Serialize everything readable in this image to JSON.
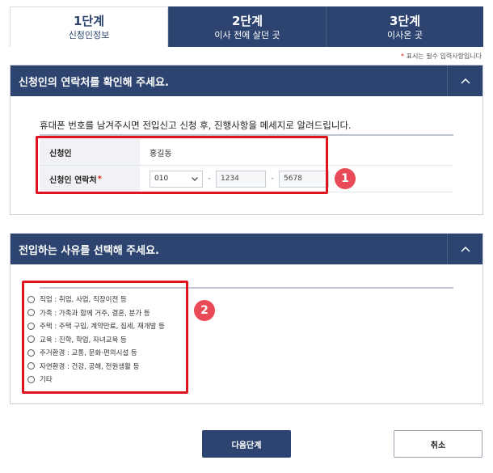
{
  "steps": [
    {
      "num": "1단계",
      "label": "신청인정보",
      "active": true
    },
    {
      "num": "2단계",
      "label": "이사 전에 살던 곳",
      "active": false
    },
    {
      "num": "3단계",
      "label": "이사온 곳",
      "active": false
    }
  ],
  "required_note": {
    "star": "*",
    "text": " 표시는 필수 입력사항입니다"
  },
  "section1": {
    "title": "신청인의 연락처를 확인해 주세요.",
    "description": "휴대폰 번호를 남겨주시면 전입신고 신청 후, 진행사항을 메세지로 알려드립니다.",
    "name_label": "신청인",
    "name_value": "홍길동",
    "phone_label": "신청인 연락처",
    "phone_required": "*",
    "phone_prefix": "010",
    "phone_dash": "-",
    "phone_middle": "1234",
    "phone_last": "5678"
  },
  "section2": {
    "title": "전입하는 사유를 선택해 주세요.",
    "options": [
      "직업 : 취업, 사업, 직장이전 등",
      "가족 : 가족과 함께 거주, 결혼, 분가 등",
      "주택 : 주택 구입, 계약만료, 집세, 재개발 등",
      "교육 : 진학, 학업, 자녀교육 등",
      "주거환경 : 교통, 문화·편의시설 등",
      "자연환경 : 건강, 공해, 전원생활 등",
      "기타"
    ]
  },
  "badges": {
    "one": "1",
    "two": "2"
  },
  "buttons": {
    "next": "다음단계",
    "cancel": "취소"
  },
  "colors": {
    "primary": "#2d4470",
    "highlight": "#e0141e",
    "badge": "#e84a57"
  }
}
